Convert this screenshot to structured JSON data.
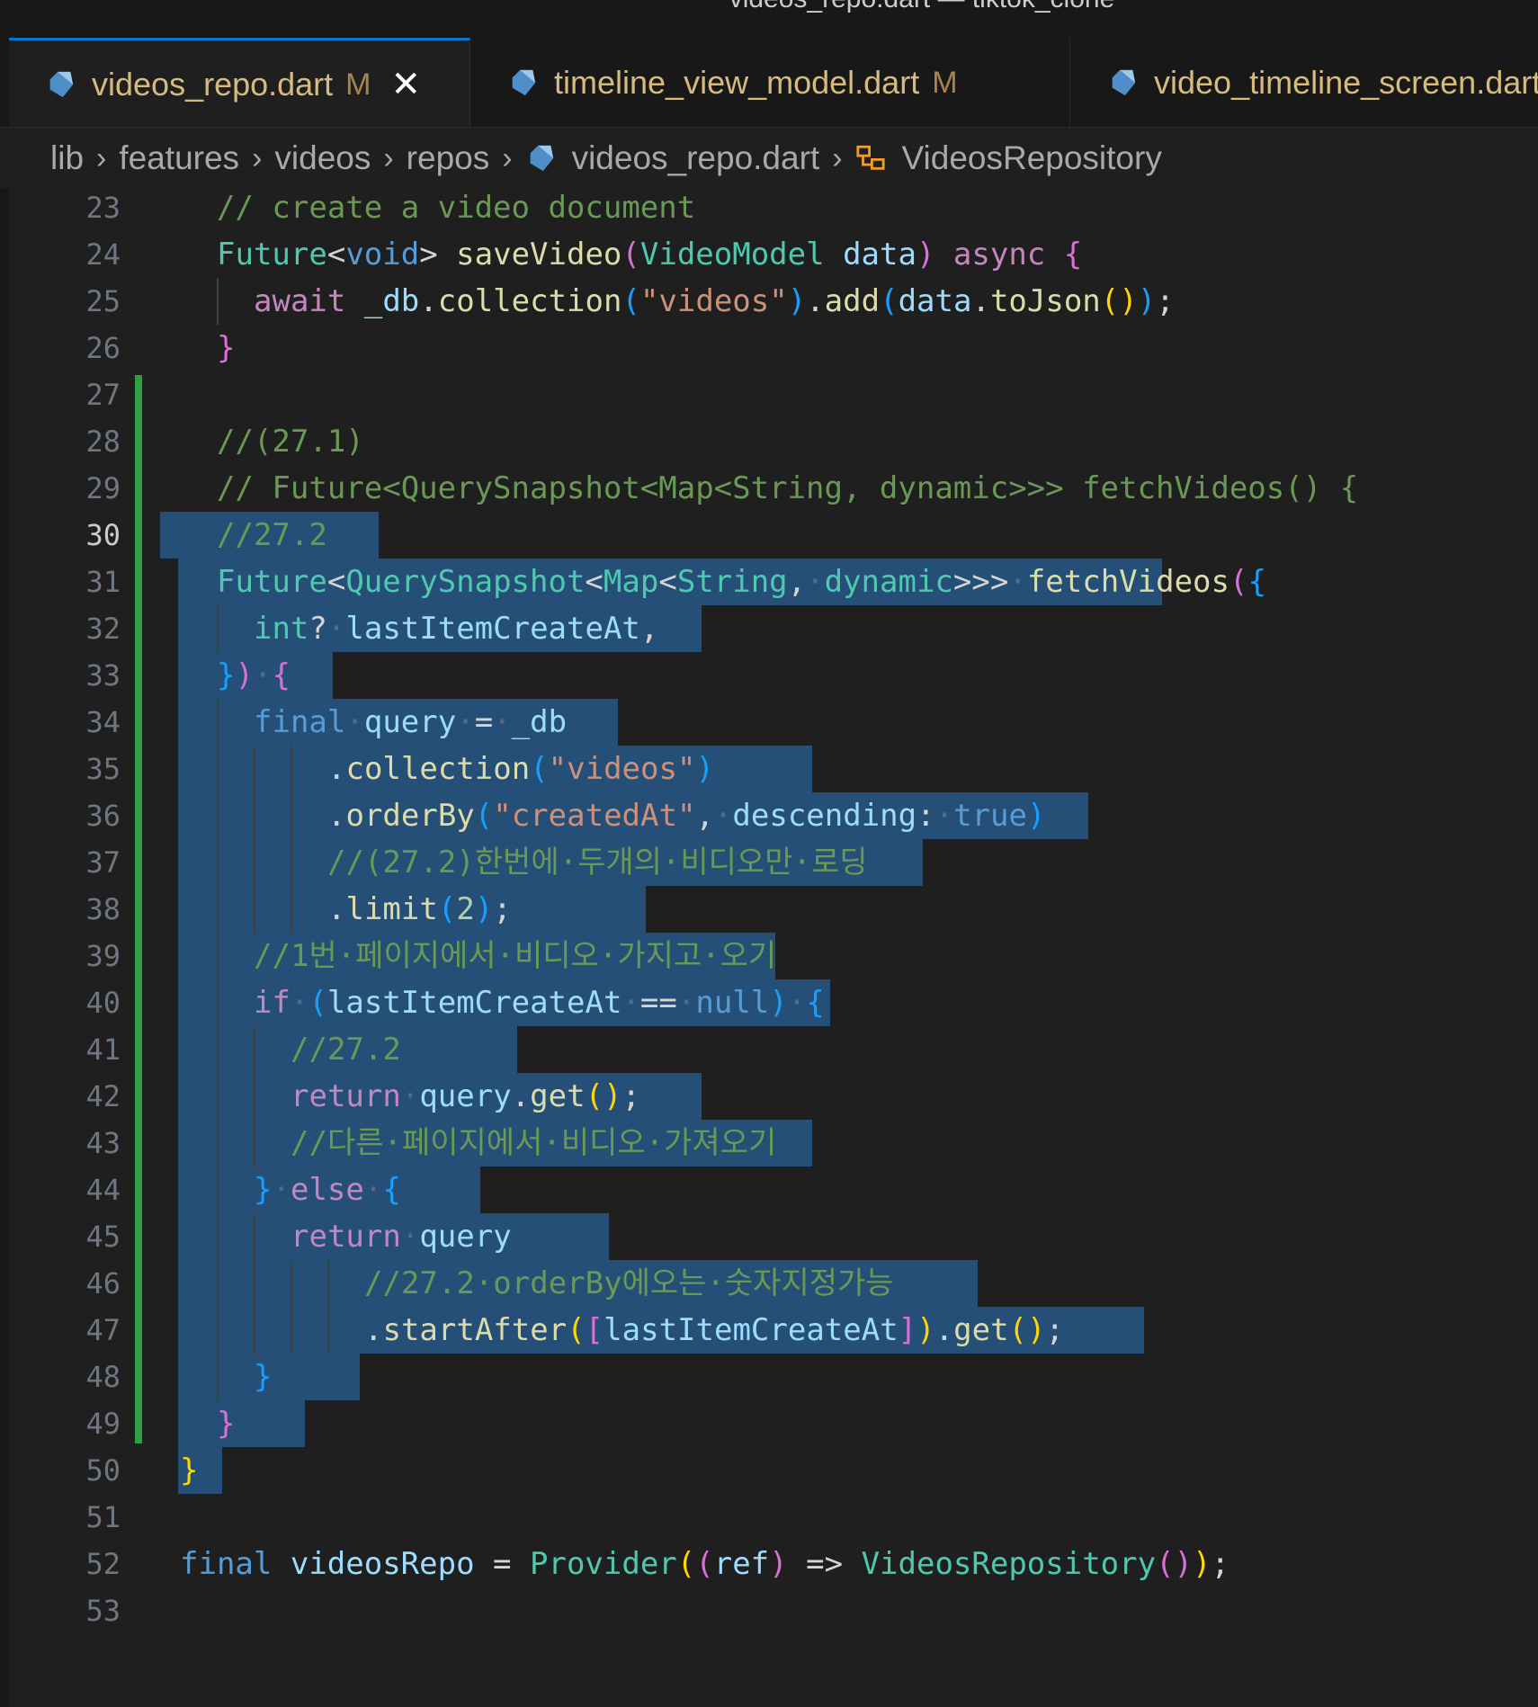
{
  "window": {
    "title": "videos_repo.dart — tiktok_clone"
  },
  "tabs": [
    {
      "label": "videos_repo.dart",
      "modified": "M",
      "close": "✕",
      "active": true
    },
    {
      "label": "timeline_view_model.dart",
      "modified": "M",
      "active": false
    },
    {
      "label": "video_timeline_screen.dart",
      "active": false
    }
  ],
  "breadcrumb": [
    "lib",
    "features",
    "videos",
    "repos",
    "videos_repo.dart",
    "VideosRepository"
  ],
  "editor": {
    "first_line": 23,
    "current_line": 30,
    "line_numbers": [
      "23",
      "24",
      "25",
      "26",
      "27",
      "28",
      "29",
      "30",
      "31",
      "32",
      "33",
      "34",
      "35",
      "36",
      "37",
      "38",
      "39",
      "40",
      "41",
      "42",
      "43",
      "44",
      "45",
      "46",
      "47",
      "48",
      "49",
      "50",
      "51",
      "52",
      "53"
    ],
    "lines": [
      {
        "indent": 1,
        "tokens": [
          [
            "// create a video document",
            "c-cmt"
          ]
        ]
      },
      {
        "indent": 1,
        "tokens": [
          [
            "Future",
            "c-type"
          ],
          [
            "<",
            "c-pun"
          ],
          [
            "void",
            "c-kw"
          ],
          [
            "> ",
            "c-pun"
          ],
          [
            "saveVideo",
            "c-fn"
          ],
          [
            "(",
            "c-b2"
          ],
          [
            "VideoModel",
            "c-type"
          ],
          [
            " ",
            "c-pun"
          ],
          [
            "data",
            "c-var"
          ],
          [
            ")",
            "c-b2"
          ],
          [
            " ",
            "c-pun"
          ],
          [
            "async",
            "c-ctl"
          ],
          [
            " ",
            "c-pun"
          ],
          [
            "{",
            "c-b2"
          ]
        ]
      },
      {
        "indent": 2,
        "tokens": [
          [
            "await",
            "c-ctl"
          ],
          [
            " ",
            "c-pun"
          ],
          [
            "_db",
            "c-var"
          ],
          [
            ".",
            "c-pun"
          ],
          [
            "collection",
            "c-fn"
          ],
          [
            "(",
            "c-b3"
          ],
          [
            "\"videos\"",
            "c-str"
          ],
          [
            ")",
            "c-b3"
          ],
          [
            ".",
            "c-pun"
          ],
          [
            "add",
            "c-fn"
          ],
          [
            "(",
            "c-b3"
          ],
          [
            "data",
            "c-var"
          ],
          [
            ".",
            "c-pun"
          ],
          [
            "toJson",
            "c-fn"
          ],
          [
            "()",
            "c-b1"
          ],
          [
            ")",
            "c-b3"
          ],
          [
            ";",
            "c-pun"
          ]
        ]
      },
      {
        "indent": 1,
        "tokens": [
          [
            "}",
            "c-b2"
          ]
        ]
      },
      {
        "indent": 0,
        "tokens": []
      },
      {
        "indent": 1,
        "tokens": [
          [
            "//(27.1)",
            "c-cmt"
          ]
        ]
      },
      {
        "indent": 1,
        "tokens": [
          [
            "// Future<QuerySnapshot<Map<String, dynamic>>> fetchVideos() {",
            "c-cmt"
          ]
        ]
      },
      {
        "indent": 1,
        "tokens": [
          [
            "//27.2",
            "c-cmt"
          ]
        ]
      },
      {
        "indent": 1,
        "tokens": [
          [
            "Future",
            "c-type"
          ],
          [
            "<",
            "c-pun"
          ],
          [
            "QuerySnapshot",
            "c-type"
          ],
          [
            "<",
            "c-pun"
          ],
          [
            "Map",
            "c-type"
          ],
          [
            "<",
            "c-pun"
          ],
          [
            "String",
            "c-type"
          ],
          [
            ",",
            "c-pun"
          ],
          [
            "·",
            "c-ws"
          ],
          [
            "dynamic",
            "c-type"
          ],
          [
            ">>>",
            "c-pun"
          ],
          [
            "·",
            "c-ws"
          ],
          [
            "fetchVideos",
            "c-fn"
          ],
          [
            "(",
            "c-b2"
          ],
          [
            "{",
            "c-b3"
          ]
        ]
      },
      {
        "indent": 2,
        "tokens": [
          [
            "int",
            "c-type"
          ],
          [
            "?",
            "c-pun"
          ],
          [
            "·",
            "c-ws"
          ],
          [
            "lastItemCreateAt",
            "c-var"
          ],
          [
            ",",
            "c-pun"
          ]
        ]
      },
      {
        "indent": 1,
        "tokens": [
          [
            "}",
            "c-b3"
          ],
          [
            ")",
            "c-b2"
          ],
          [
            "·",
            "c-ws"
          ],
          [
            "{",
            "c-b2"
          ]
        ]
      },
      {
        "indent": 2,
        "tokens": [
          [
            "final",
            "c-kw"
          ],
          [
            "·",
            "c-ws"
          ],
          [
            "query",
            "c-var"
          ],
          [
            "·",
            "c-ws"
          ],
          [
            "=",
            "c-pun"
          ],
          [
            "·",
            "c-ws"
          ],
          [
            "_db",
            "c-var"
          ]
        ]
      },
      {
        "indent": 4,
        "tokens": [
          [
            ".",
            "c-pun"
          ],
          [
            "collection",
            "c-fn"
          ],
          [
            "(",
            "c-b3"
          ],
          [
            "\"videos\"",
            "c-str"
          ],
          [
            ")",
            "c-b3"
          ]
        ]
      },
      {
        "indent": 4,
        "tokens": [
          [
            ".",
            "c-pun"
          ],
          [
            "orderBy",
            "c-fn"
          ],
          [
            "(",
            "c-b3"
          ],
          [
            "\"createdAt\"",
            "c-str"
          ],
          [
            ",",
            "c-pun"
          ],
          [
            "·",
            "c-ws"
          ],
          [
            "descending",
            "c-var"
          ],
          [
            ":",
            "c-pun"
          ],
          [
            "·",
            "c-ws"
          ],
          [
            "true",
            "c-kw"
          ],
          [
            ")",
            "c-b3"
          ]
        ]
      },
      {
        "indent": 4,
        "tokens": [
          [
            "//(27.2)한번에·두개의·비디오만·로딩",
            "c-cmt"
          ]
        ]
      },
      {
        "indent": 4,
        "tokens": [
          [
            ".",
            "c-pun"
          ],
          [
            "limit",
            "c-fn"
          ],
          [
            "(",
            "c-b3"
          ],
          [
            "2",
            "c-num"
          ],
          [
            ")",
            "c-b3"
          ],
          [
            ";",
            "c-pun"
          ]
        ]
      },
      {
        "indent": 2,
        "tokens": [
          [
            "//1번·페이지에서·비디오·가지고·오기",
            "c-cmt"
          ]
        ]
      },
      {
        "indent": 2,
        "tokens": [
          [
            "if",
            "c-ctl"
          ],
          [
            "·",
            "c-ws"
          ],
          [
            "(",
            "c-b3"
          ],
          [
            "lastItemCreateAt",
            "c-var"
          ],
          [
            "·",
            "c-ws"
          ],
          [
            "==",
            "c-pun"
          ],
          [
            "·",
            "c-ws"
          ],
          [
            "null",
            "c-kw"
          ],
          [
            ")",
            "c-b3"
          ],
          [
            "·",
            "c-ws"
          ],
          [
            "{",
            "c-b3"
          ]
        ]
      },
      {
        "indent": 3,
        "tokens": [
          [
            "//27.2",
            "c-cmt"
          ]
        ]
      },
      {
        "indent": 3,
        "tokens": [
          [
            "return",
            "c-ctl"
          ],
          [
            "·",
            "c-ws"
          ],
          [
            "query",
            "c-var"
          ],
          [
            ".",
            "c-pun"
          ],
          [
            "get",
            "c-fn"
          ],
          [
            "()",
            "c-b1"
          ],
          [
            ";",
            "c-pun"
          ]
        ]
      },
      {
        "indent": 3,
        "tokens": [
          [
            "//다른·페이지에서·비디오·가져오기",
            "c-cmt"
          ]
        ]
      },
      {
        "indent": 2,
        "tokens": [
          [
            "}",
            "c-b3"
          ],
          [
            "·",
            "c-ws"
          ],
          [
            "else",
            "c-ctl"
          ],
          [
            "·",
            "c-ws"
          ],
          [
            "{",
            "c-b3"
          ]
        ]
      },
      {
        "indent": 3,
        "tokens": [
          [
            "return",
            "c-ctl"
          ],
          [
            "·",
            "c-ws"
          ],
          [
            "query",
            "c-var"
          ]
        ]
      },
      {
        "indent": 5,
        "tokens": [
          [
            "//27.2·orderBy에오는·숫자지정가능",
            "c-cmt"
          ]
        ]
      },
      {
        "indent": 5,
        "tokens": [
          [
            ".",
            "c-pun"
          ],
          [
            "startAfter",
            "c-fn"
          ],
          [
            "(",
            "c-b1"
          ],
          [
            "[",
            "c-b2"
          ],
          [
            "lastItemCreateAt",
            "c-var"
          ],
          [
            "]",
            "c-b2"
          ],
          [
            ")",
            "c-b1"
          ],
          [
            ".",
            "c-pun"
          ],
          [
            "get",
            "c-fn"
          ],
          [
            "()",
            "c-b1"
          ],
          [
            ";",
            "c-pun"
          ]
        ]
      },
      {
        "indent": 2,
        "tokens": [
          [
            "}",
            "c-b3"
          ]
        ]
      },
      {
        "indent": 1,
        "tokens": [
          [
            "}",
            "c-b2"
          ]
        ]
      },
      {
        "indent": 0,
        "tokens": [
          [
            "}",
            "c-b1"
          ]
        ]
      },
      {
        "indent": 0,
        "tokens": []
      },
      {
        "indent": 0,
        "tokens": [
          [
            "final",
            "c-kw"
          ],
          [
            " ",
            "c-pun"
          ],
          [
            "videosRepo",
            "c-var"
          ],
          [
            " ",
            "c-pun"
          ],
          [
            "=",
            "c-pun"
          ],
          [
            " ",
            "c-pun"
          ],
          [
            "Provider",
            "c-type"
          ],
          [
            "(",
            "c-b1"
          ],
          [
            "(",
            "c-b2"
          ],
          [
            "ref",
            "c-var"
          ],
          [
            ")",
            "c-b2"
          ],
          [
            " ",
            "c-pun"
          ],
          [
            "=>",
            "c-pun"
          ],
          [
            " ",
            "c-pun"
          ],
          [
            "VideosRepository",
            "c-type"
          ],
          [
            "()",
            "c-b2"
          ],
          [
            ")",
            "c-b1"
          ],
          [
            ";",
            "c-pun"
          ]
        ]
      },
      {
        "indent": 0,
        "tokens": []
      }
    ]
  }
}
